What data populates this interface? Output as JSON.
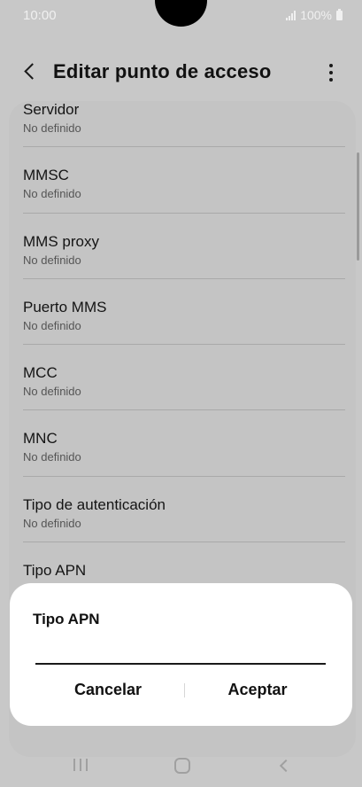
{
  "status_bar": {
    "time": "10:00",
    "battery": "100%",
    "icons": [
      "signal-icon",
      "battery-icon"
    ]
  },
  "header": {
    "title": "Editar punto de acceso",
    "back_icon": "chevron-left-icon",
    "menu_icon": "more-vertical-icon"
  },
  "settings": {
    "items": [
      {
        "label": "Servidor",
        "value": "No definido"
      },
      {
        "label": "MMSC",
        "value": "No definido"
      },
      {
        "label": "MMS proxy",
        "value": "No definido"
      },
      {
        "label": "Puerto MMS",
        "value": "No definido"
      },
      {
        "label": "MCC",
        "value": "No definido"
      },
      {
        "label": "MNC",
        "value": "No definido"
      },
      {
        "label": "Tipo de autenticación",
        "value": "No definido"
      },
      {
        "label": "Tipo APN",
        "value": ""
      }
    ]
  },
  "dialog": {
    "title": "Tipo APN",
    "input_value": "",
    "cancel_label": "Cancelar",
    "accept_label": "Aceptar"
  },
  "nav_bar": {
    "icons": [
      "recents-icon",
      "home-icon",
      "back-icon"
    ]
  }
}
